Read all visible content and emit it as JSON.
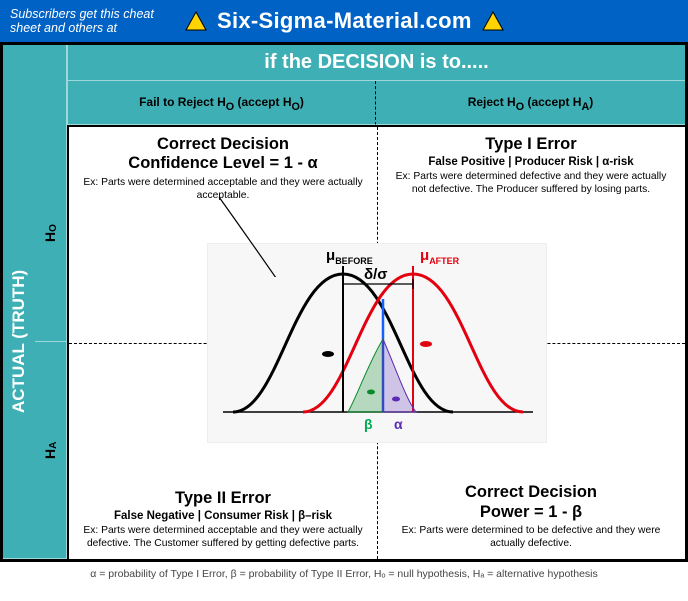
{
  "banner": {
    "sub": "Subscribers get this cheat sheet and others at",
    "title": "Six-Sigma-Material.com"
  },
  "headers": {
    "decision": "if the DECISION is to.....",
    "fail_main": "Fail to Reject H",
    "fail_sub": "O",
    "fail_paren": " (accept H",
    "fail_paren_sub": "O",
    "fail_paren_end": ")",
    "rej_main": "Reject H",
    "rej_sub": "O",
    "rej_paren": " (accept H",
    "rej_paren_sub": "A",
    "rej_paren_end": ")"
  },
  "side": {
    "actual": "ACTUAL (TRUTH)",
    "ho": "H",
    "ho_sub": "O",
    "ha": "H",
    "ha_sub": "A"
  },
  "quad": {
    "tl": {
      "t1": "Correct Decision",
      "t2": "Confidence Level = 1 - α",
      "ex": "Ex: Parts were determined acceptable and they were actually acceptable."
    },
    "tr": {
      "t1": "Type I Error",
      "h4": "False Positive | Producer Risk | α-risk",
      "ex": "Ex: Parts were determined defective and they were actually not defective. The Producer suffered by losing parts."
    },
    "bl": {
      "t1": "Type II Error",
      "h4": "False Negative | Consumer Risk | β–risk",
      "ex": "Ex: Parts were determined acceptable and they were actually defective. The Customer suffered by getting defective parts."
    },
    "br": {
      "t1": "Correct Decision",
      "t2": "Power = 1 - β",
      "ex": "Ex: Parts were determined to be defective and they were actually defective."
    }
  },
  "curve_labels": {
    "mu_before": "μ",
    "mu_before_sub": "BEFORE",
    "mu_after": "μ",
    "mu_after_sub": "AFTER",
    "delta": "δ/σ",
    "alpha": "α",
    "beta": "β"
  },
  "footer": "α = probability of Type I Error,  β = probability of Type II Error,  Hₒ = null hypothesis,  Hₐ = alternative hypothesis",
  "chart_data": {
    "type": "line",
    "title": "Overlapping normal distributions (before vs after)",
    "series": [
      {
        "name": "μ_BEFORE",
        "color": "#000000",
        "mean": 0,
        "sd": 1
      },
      {
        "name": "μ_AFTER",
        "color": "#e3000f",
        "mean": 1.6,
        "sd": 1
      }
    ],
    "regions": [
      {
        "name": "β",
        "color": "#0a8a2a",
        "desc": "area of after-curve left of decision boundary"
      },
      {
        "name": "α",
        "color": "#5b2bb5",
        "desc": "area of before-curve right of decision boundary"
      }
    ],
    "decision_boundary_x": 0.8,
    "xlabel": "",
    "ylabel": "",
    "annotations": [
      "μ_BEFORE",
      "μ_AFTER",
      "δ/σ",
      "α",
      "β"
    ]
  }
}
